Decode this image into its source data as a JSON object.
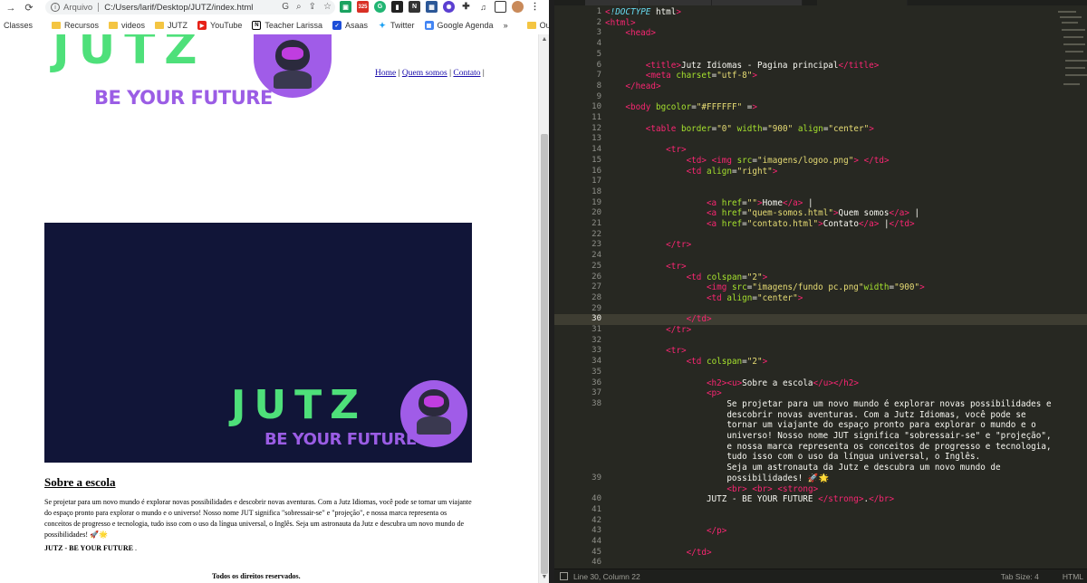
{
  "browser": {
    "address_scheme": "Arquivo",
    "address_path": "C:/Users/larif/Desktop/JUTZ/index.html",
    "ext_badge": "325",
    "bookmarks": [
      {
        "label": "Classes",
        "kind": "text"
      },
      {
        "label": "Recursos",
        "kind": "folder"
      },
      {
        "label": "videos",
        "kind": "folder"
      },
      {
        "label": "JUTZ",
        "kind": "folder"
      },
      {
        "label": "YouTube",
        "kind": "youtube"
      },
      {
        "label": "Teacher Larissa",
        "kind": "notion"
      },
      {
        "label": "Asaas",
        "kind": "asaas"
      },
      {
        "label": "Twitter",
        "kind": "twitter"
      },
      {
        "label": "Google Agenda",
        "kind": "calendar"
      },
      {
        "label": "»",
        "kind": "more"
      },
      {
        "label": "Outros favoritos",
        "kind": "folder"
      }
    ]
  },
  "page": {
    "logo_word": "JUTZ",
    "logo_tagline": "BE YOUR FUTURE",
    "nav": [
      {
        "label": "Home"
      },
      {
        "label": "Quem somos"
      },
      {
        "label": "Contato"
      }
    ],
    "nav_sep": "|",
    "about_title": "Sobre a escola",
    "about_text": "Se projetar para um novo mundo é explorar novas possibilidades e descobrir novas aventuras. Com a Jutz Idiomas, você pode se tornar um viajante do espaço pronto para explorar o mundo e o universo! Nosso nome JUT significa \"sobressair-se\" e \"projeção\", e nossa marca representa os conceitos de progresso e tecnologia, tudo isso com o uso da língua universal, o Inglês. Seja um astronauta da Jutz e descubra um novo mundo de possibilidades! 🚀🌟",
    "about_strong": "JUTZ - BE YOUR FUTURE",
    "about_strong_after": " .",
    "footer": "Todos os direitos reservados."
  },
  "editor": {
    "status_position": "Line 30, Column 22",
    "status_tabsize": "Tab Size: 4",
    "status_syntax": "HTML",
    "current_line": 30,
    "line_numbers": [
      "1",
      "2",
      "3",
      "4",
      "5",
      "6",
      "7",
      "8",
      "9",
      "10",
      "11",
      "12",
      "13",
      "14",
      "15",
      "16",
      "17",
      "18",
      "19",
      "20",
      "21",
      "22",
      "23",
      "24",
      "25",
      "26",
      "27",
      "28",
      "29",
      "30",
      "31",
      "32",
      "33",
      "34",
      "35",
      "36",
      "37",
      "38",
      "",
      "",
      "",
      "",
      "",
      "",
      "39",
      "",
      "40",
      "41",
      "42",
      "43",
      "44",
      "45",
      "46"
    ],
    "lines": [
      "<!DOCTYPE html>",
      "<html>",
      "    <head>",
      "",
      "",
      "        <title>Jutz Idiomas - Pagina principal</title>",
      "        <meta charset=\"utf-8\">",
      "    </head>",
      "",
      "    <body bgcolor=\"#FFFFFF\" =>",
      "",
      "        <table border=\"0\" width=\"900\" align=\"center\">",
      "",
      "            <tr>",
      "                <td> <img src=\"imagens/logoo.png\"> </td>",
      "                <td align=\"right\">",
      "",
      "",
      "                    <a href=\"\">Home</a> |",
      "                    <a href=\"quem-somos.html\">Quem somos</a> |",
      "                    <a href=\"contato.html\">Contato</a> |</td>",
      "",
      "            </tr>",
      "",
      "            <tr>",
      "                <td colspan=\"2\">",
      "                    <img src=\"imagens/fundo pc.png\"width=\"900\">",
      "                    <td align=\"center\">",
      "",
      "                </td>",
      "            </tr>",
      "",
      "            <tr>",
      "                <td colspan=\"2\">",
      "",
      "                    <h2><u>Sobre a escola</u></h2>",
      "                    <p>",
      "                        Se projetar para um novo mundo é explorar novas possibilidades e",
      "                        descobrir novas aventuras. Com a Jutz Idiomas, você pode se",
      "                        tornar um viajante do espaço pronto para explorar o mundo e o",
      "                        universo! Nosso nome JUT significa \"sobressair-se\" e \"projeção\",",
      "                        e nossa marca representa os conceitos de progresso e tecnologia,",
      "                        tudo isso com o uso da língua universal, o Inglês.",
      "                        Seja um astronauta da Jutz e descubra um novo mundo de",
      "                        possibilidades! 🚀🌟",
      "                        <br> <br> <strong>",
      "                    JUTZ - BE YOUR FUTURE </strong>.</br>",
      "",
      "",
      "                    </p>",
      "",
      "                </td>",
      ""
    ]
  }
}
